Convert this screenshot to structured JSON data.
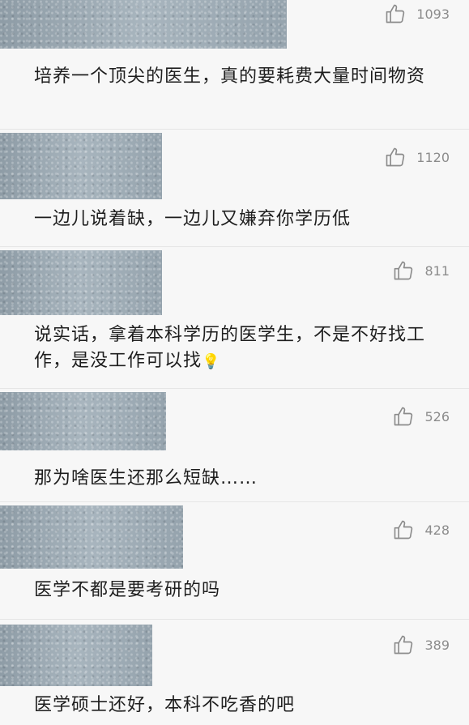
{
  "comments": [
    {
      "likes": "1093",
      "text": "培养一个顶尖的医生，真的要耗费大量时间物资"
    },
    {
      "likes": "1120",
      "text": "一边儿说着缺，一边儿又嫌弃你学历低"
    },
    {
      "likes": "811",
      "text": "说实话，拿着本科学历的医学生，不是不好找工作，是没工作可以找",
      "emoji": "💡"
    },
    {
      "likes": "526",
      "text": "那为啥医生还那么短缺……"
    },
    {
      "likes": "428",
      "text": "医学不都是要考研的吗"
    },
    {
      "likes": "389",
      "text": "医学硕士还好，本科不吃香的吧"
    }
  ],
  "icons": {
    "like": "thumbs-up-icon"
  },
  "colors": {
    "background": "#f7f7f7",
    "text": "#1e1e1e",
    "like": "#8c8c8c",
    "blur": "#9aa8b2"
  }
}
